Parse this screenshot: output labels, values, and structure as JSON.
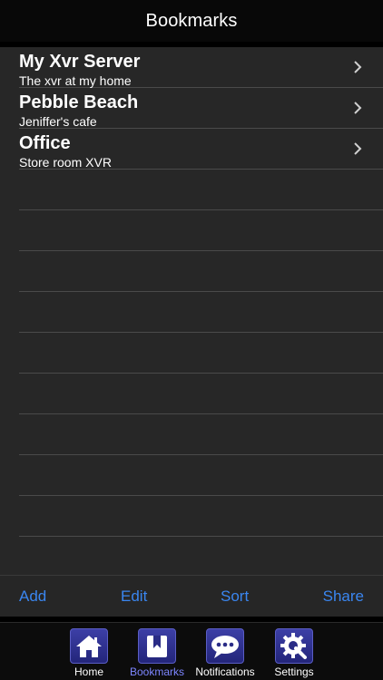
{
  "navbar": {
    "title": "Bookmarks"
  },
  "bookmarks": [
    {
      "title": "My Xvr Server",
      "subtitle": "The xvr at my home"
    },
    {
      "title": "Pebble Beach",
      "subtitle": "Jeniffer's cafe"
    },
    {
      "title": "Office",
      "subtitle": "Store room XVR"
    }
  ],
  "toolbar": {
    "add": "Add",
    "edit": "Edit",
    "sort": "Sort",
    "share": "Share"
  },
  "tabs": [
    {
      "label": "Home",
      "icon": "home-icon"
    },
    {
      "label": "Bookmarks",
      "icon": "bookmark-icon",
      "active": true
    },
    {
      "label": "Notifications",
      "icon": "chat-bubble-icon"
    },
    {
      "label": "Settings",
      "icon": "gear-wrench-icon"
    }
  ],
  "colors": {
    "accent": "#3a86f0",
    "active_tab": "#7d86ff",
    "list_bg": "#272727"
  }
}
